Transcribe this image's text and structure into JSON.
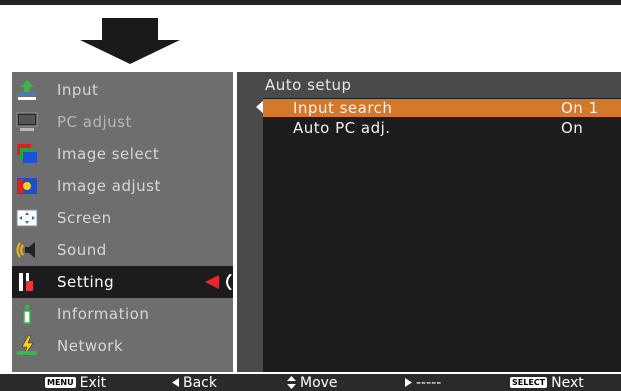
{
  "menu": {
    "items": [
      {
        "label": "Input",
        "icon": "input-icon",
        "state": "normal"
      },
      {
        "label": "PC adjust",
        "icon": "pc-adjust-icon",
        "state": "dim"
      },
      {
        "label": "Image select",
        "icon": "image-select-icon",
        "state": "normal"
      },
      {
        "label": "Image adjust",
        "icon": "image-adjust-icon",
        "state": "normal"
      },
      {
        "label": "Screen",
        "icon": "screen-icon",
        "state": "normal"
      },
      {
        "label": "Sound",
        "icon": "sound-icon",
        "state": "normal"
      },
      {
        "label": "Setting",
        "icon": "setting-icon",
        "state": "active"
      },
      {
        "label": "Information",
        "icon": "information-icon",
        "state": "normal"
      },
      {
        "label": "Network",
        "icon": "network-icon",
        "state": "normal"
      }
    ]
  },
  "panel": {
    "title": "Auto setup",
    "rows": [
      {
        "label": "Input search",
        "value": "On 1",
        "selected": true
      },
      {
        "label": "Auto PC adj.",
        "value": "On",
        "selected": false
      }
    ]
  },
  "footer": {
    "exit_key": "MENU",
    "exit_label": "Exit",
    "back_label": "Back",
    "move_label": "Move",
    "dash_label": "-----",
    "next_key": "SELECT",
    "next_label": "Next"
  },
  "colors": {
    "highlight": "#d4782a",
    "pointer": "#e8262c",
    "sidebar_bg": "#6e6e6e",
    "panel_bg": "#1c1c1c"
  }
}
